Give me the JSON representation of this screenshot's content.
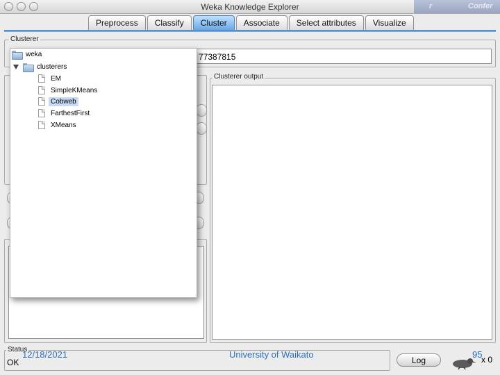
{
  "window": {
    "title": "Weka Knowledge Explorer",
    "background_window_fragments": [
      "r",
      "Confer"
    ]
  },
  "tabs": [
    {
      "label": "Preprocess",
      "active": false
    },
    {
      "label": "Classify",
      "active": false
    },
    {
      "label": "Cluster",
      "active": true
    },
    {
      "label": "Associate",
      "active": false
    },
    {
      "label": "Select attributes",
      "active": false
    },
    {
      "label": "Visualize",
      "active": false
    }
  ],
  "clusterer": {
    "group_label": "Clusterer",
    "field_value_visible": "77387815"
  },
  "output": {
    "group_label": "Clusterer output"
  },
  "tree": {
    "root": "weka",
    "folder": "clusterers",
    "items": [
      {
        "label": "EM",
        "selected": false
      },
      {
        "label": "SimpleKMeans",
        "selected": false
      },
      {
        "label": "Cobweb",
        "selected": true
      },
      {
        "label": "FarthestFirst",
        "selected": false
      },
      {
        "label": "XMeans",
        "selected": false
      }
    ]
  },
  "status": {
    "group_label": "Status",
    "text": "OK",
    "log_button": "Log",
    "count": "x 0"
  },
  "footer": {
    "date": "12/18/2021",
    "org": "University of Waikato",
    "page": "95"
  },
  "colors": {
    "active_tab": "#6aa8e6",
    "selection": "#c7daf5",
    "footer_text": "#2a6fb7"
  }
}
